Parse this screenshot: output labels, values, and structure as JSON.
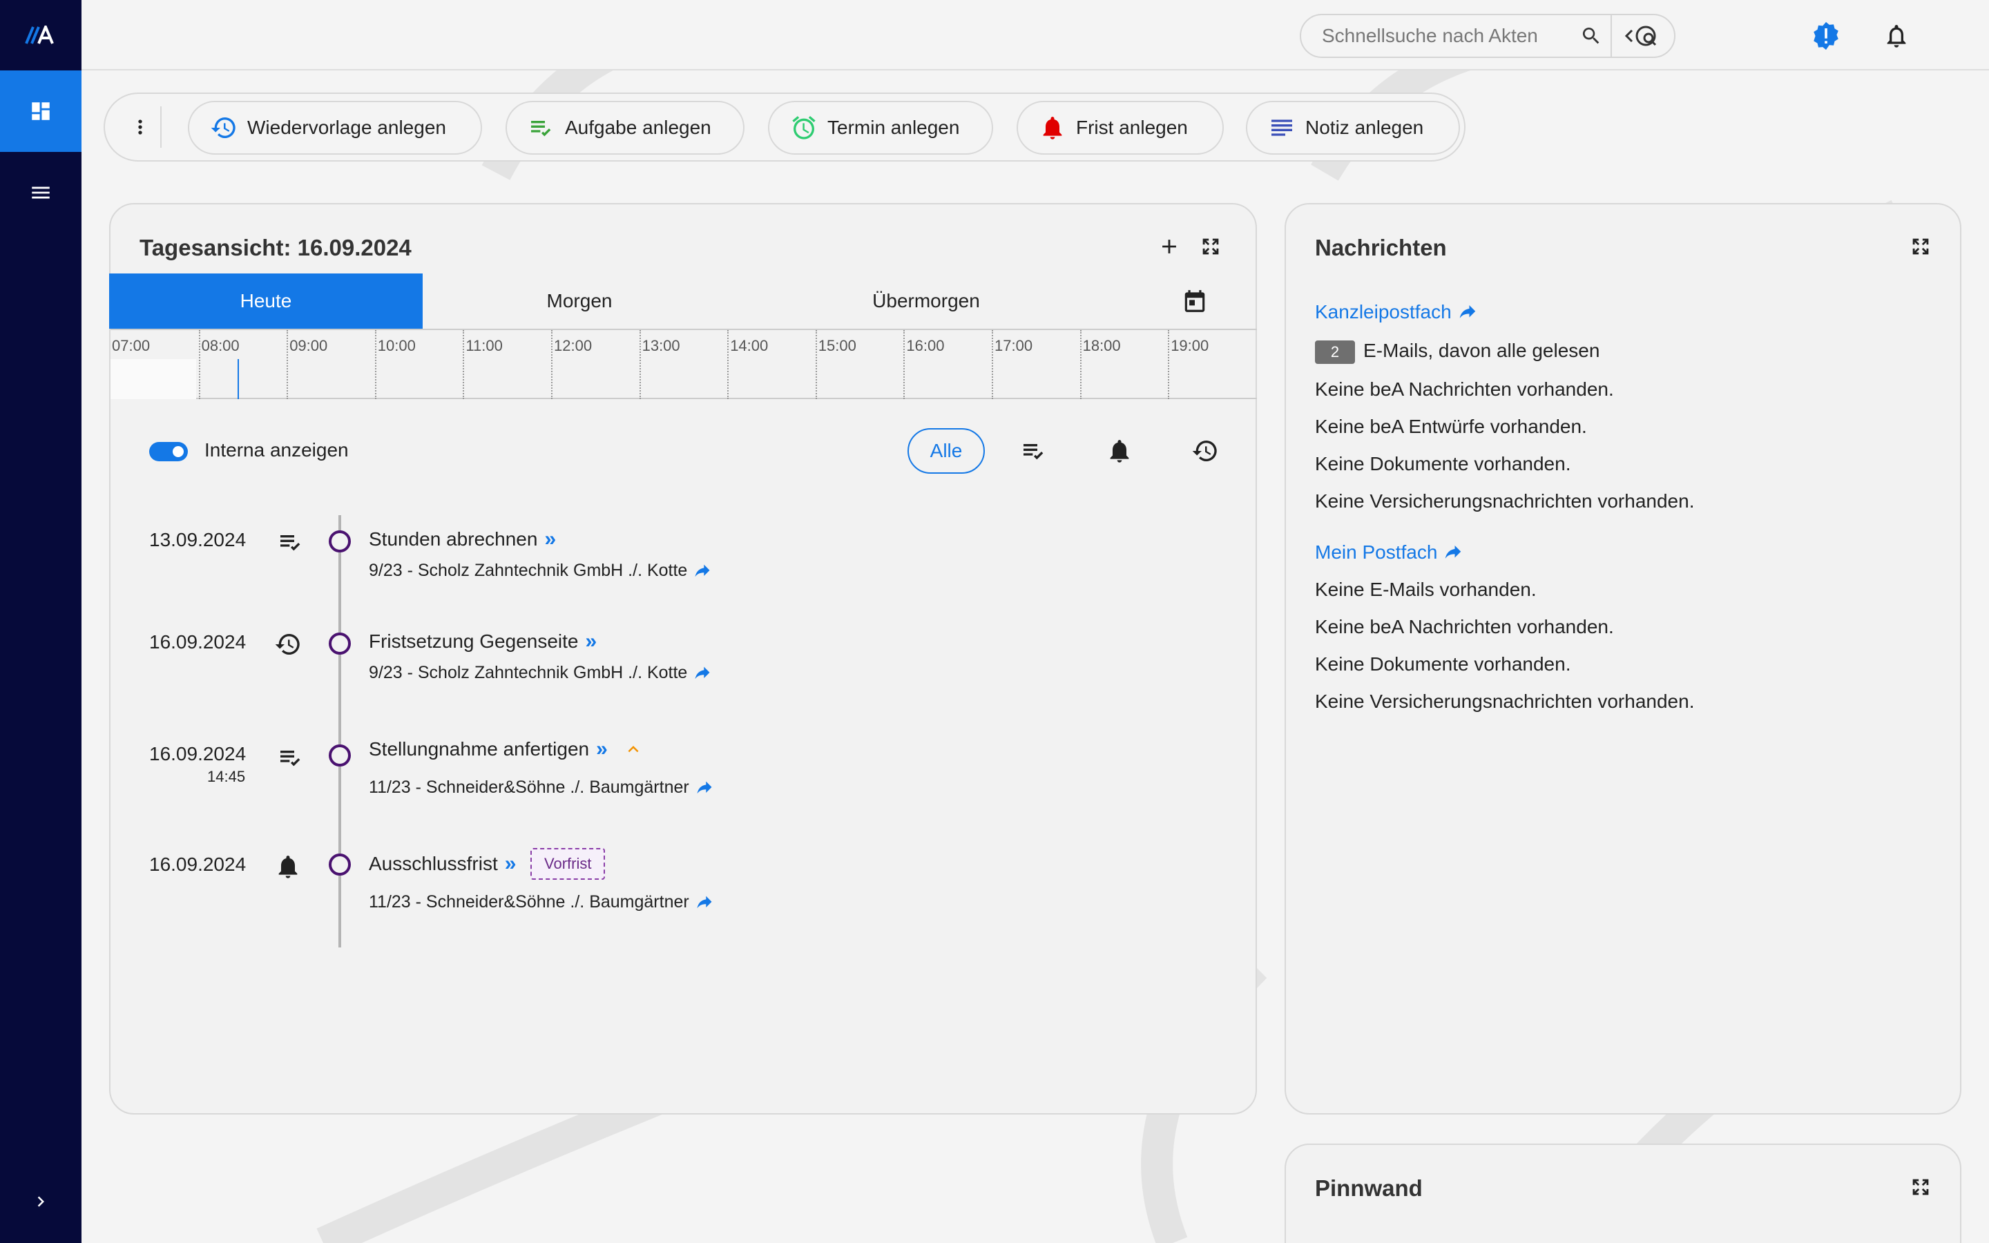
{
  "search": {
    "placeholder": "Schnellsuche nach Akten"
  },
  "toolbar": {
    "actions": [
      {
        "label": "Wiedervorlage anlegen"
      },
      {
        "label": "Aufgabe anlegen"
      },
      {
        "label": "Termin anlegen"
      },
      {
        "label": "Frist anlegen"
      },
      {
        "label": "Notiz anlegen"
      }
    ]
  },
  "day_view": {
    "title": "Tagesansicht: 16.09.2024",
    "tabs": [
      "Heute",
      "Morgen",
      "Übermorgen"
    ],
    "active_tab": "Heute",
    "hours": [
      "07:00",
      "08:00",
      "09:00",
      "10:00",
      "11:00",
      "12:00",
      "13:00",
      "14:00",
      "15:00",
      "16:00",
      "17:00",
      "18:00",
      "19:00"
    ],
    "toggle_label": "Interna anzeigen",
    "toggle_on": true,
    "filter_all": "Alle",
    "events": [
      {
        "date": "13.09.2024",
        "time": "",
        "type": "aufgabe",
        "title": "Stunden abrechnen",
        "file": "9/23 - Scholz Zahntechnik GmbH ./. Kotte"
      },
      {
        "date": "16.09.2024",
        "time": "",
        "type": "wiedervorlage",
        "title": "Fristsetzung Gegenseite",
        "file": "9/23 - Scholz Zahntechnik GmbH ./. Kotte"
      },
      {
        "date": "16.09.2024",
        "time": "14:45",
        "type": "aufgabe",
        "title": "Stellungnahme anfertigen",
        "file": "11/23 - Schneider&Söhne ./. Baumgärtner",
        "priority": "high"
      },
      {
        "date": "16.09.2024",
        "time": "",
        "type": "frist",
        "title": "Ausschlussfrist",
        "file": "11/23 - Schneider&Söhne ./. Baumgärtner",
        "badge": "Vorfrist"
      }
    ]
  },
  "messages": {
    "title": "Nachrichten",
    "kanzlei": {
      "label": "Kanzleipostfach",
      "email_count": "2",
      "email_text": "E-Mails, davon alle gelesen",
      "lines": [
        "Keine beA Nachrichten vorhanden.",
        "Keine beA Entwürfe vorhanden.",
        "Keine Dokumente vorhanden.",
        "Keine Versicherungsnachrichten vorhanden."
      ]
    },
    "mein": {
      "label": "Mein Postfach",
      "lines": [
        "Keine E-Mails vorhanden.",
        "Keine beA Nachrichten vorhanden.",
        "Keine Dokumente vorhanden.",
        "Keine Versicherungsnachrichten vorhanden."
      ]
    }
  },
  "pinnwand": {
    "title": "Pinnwand"
  },
  "colors": {
    "accent": "#1478e6",
    "sidebar": "#060a3a",
    "timeline_dot": "#4a1270",
    "priority": "#f39200",
    "frist": "#e00000",
    "aufgabe": "#3aa33a",
    "termin": "#2ecc71"
  }
}
